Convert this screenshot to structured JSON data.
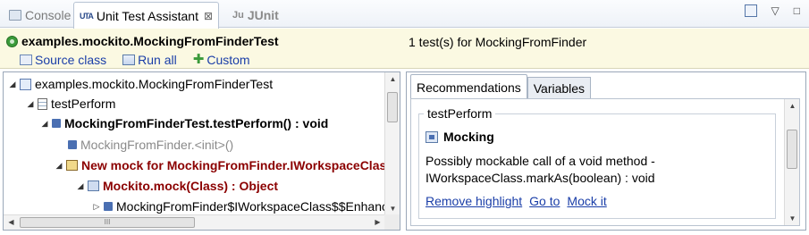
{
  "tabs": [
    {
      "label": "Console",
      "icon": "console-icon",
      "active": false
    },
    {
      "label": "Unit Test Assistant",
      "icon": "uta-icon",
      "active": true,
      "close": "⊠"
    },
    {
      "label": "JUnit",
      "icon": "junit-icon",
      "active": false
    }
  ],
  "view_tools": {
    "minimize": "▽",
    "maximize": "□"
  },
  "header": {
    "title": "examples.mockito.MockingFromFinderTest",
    "count": "1 test(s) for MockingFromFinder",
    "links": {
      "source": "Source class",
      "run": "Run all",
      "custom": "Custom"
    }
  },
  "tree": {
    "rows": [
      {
        "text": "examples.mockito.MockingFromFinderTest",
        "toggle": "◢"
      },
      {
        "text": "testPerform",
        "toggle": "◢"
      },
      {
        "text": "MockingFromFinderTest.testPerform() : void",
        "toggle": "◢"
      },
      {
        "text": "MockingFromFinder.<init>()",
        "toggle": ""
      },
      {
        "text": "New mock for MockingFromFinder.IWorkspaceClass",
        "toggle": "◢"
      },
      {
        "text": "Mockito.mock(Class) : Object",
        "toggle": "◢"
      },
      {
        "text": "MockingFromFinder$IWorkspaceClass$$EnhancerByMockito",
        "toggle": "▷"
      }
    ],
    "hthumb_label": "III"
  },
  "recommendations": {
    "tabs": [
      "Recommendations",
      "Variables"
    ],
    "group_label": "testPerform",
    "title": "Mocking",
    "desc_line1": "Possibly mockable call of a void method -",
    "desc_line2": "IWorkspaceClass.markAs(boolean) : void",
    "actions": [
      "Remove highlight",
      "Go to",
      "Mock it"
    ]
  },
  "colors": {
    "header_bg": "#fbf9e2",
    "link": "#1a3ea8",
    "mock_text": "#8b0000"
  }
}
